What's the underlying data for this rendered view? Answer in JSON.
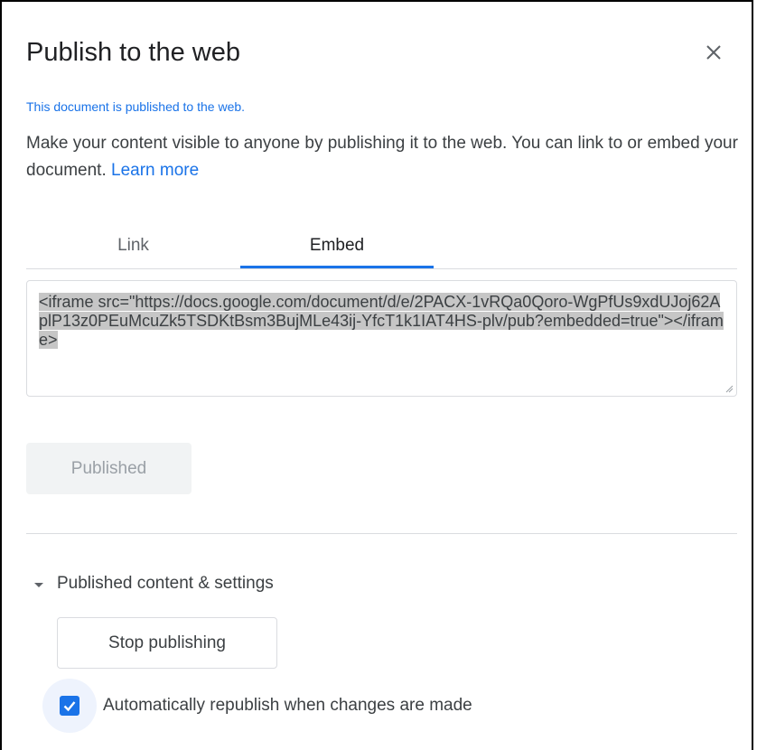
{
  "dialog": {
    "title": "Publish to the web",
    "close_icon": "close-icon",
    "status": "This document is published to the web.",
    "description": "Make your content visible to anyone by publishing it to the web. You can link to or embed your document. ",
    "learn_more": "Learn more"
  },
  "tabs": {
    "items": [
      {
        "label": "Link",
        "selected": false
      },
      {
        "label": "Embed",
        "selected": true
      }
    ]
  },
  "embed": {
    "code": "<iframe src=\"https://docs.google.com/document/d/e/2PACX-1vRQa0Qoro-WgPfUs9xdUJoj62AplP13z0PEuMcuZk5TSDKtBsm3BujMLe43ij-YfcT1k1IAT4HS-plv/pub?embedded=true\"></iframe>"
  },
  "publish": {
    "published_label": "Published"
  },
  "settings": {
    "toggle_label": "Published content & settings",
    "stop_label": "Stop publishing",
    "auto_republish_label": "Automatically republish when changes are made",
    "auto_republish_checked": true
  },
  "colors": {
    "accent": "#1a73e8",
    "text": "#3c4043",
    "divider": "#dadce0",
    "selection": "#c6c6c6"
  }
}
